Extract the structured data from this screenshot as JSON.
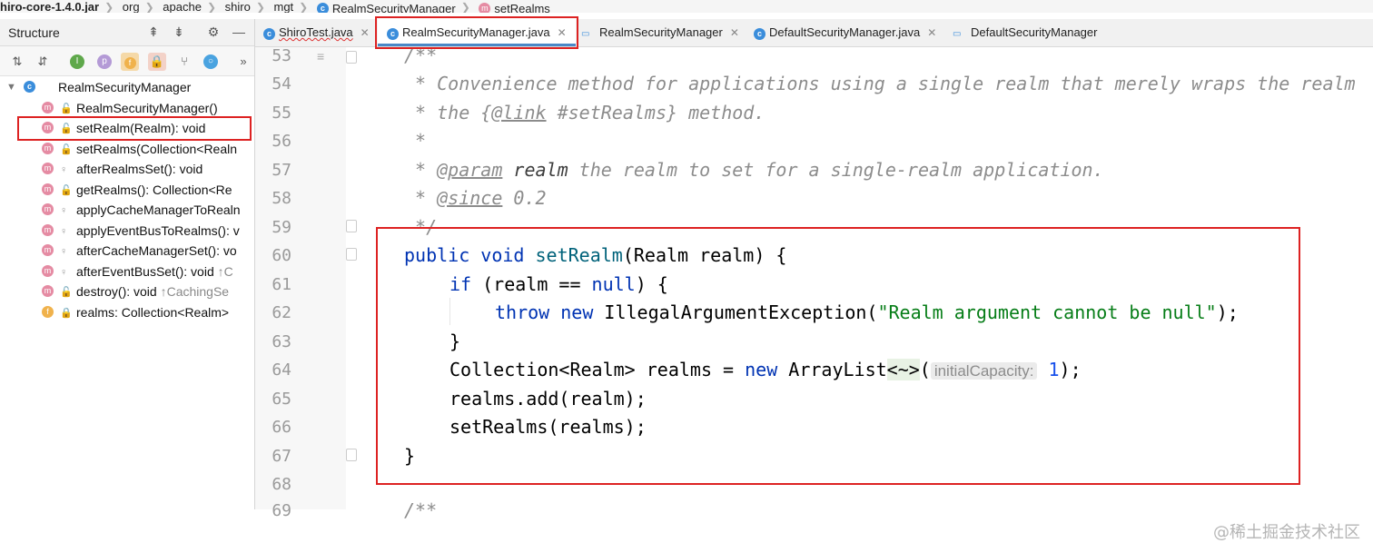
{
  "breadcrumb": [
    "hiro-core-1.4.0.jar",
    "org",
    "apache",
    "shiro",
    "mgt",
    "RealmSecurityManager",
    "setRealms"
  ],
  "structure": {
    "title": "Structure",
    "root": "RealmSecurityManager",
    "items": [
      {
        "label": "RealmSecurityManager()",
        "suffix": "",
        "kind": "m"
      },
      {
        "label": "setRealm(Realm): void",
        "suffix": "",
        "kind": "m"
      },
      {
        "label": "setRealms(Collection<Realn",
        "suffix": "",
        "kind": "m"
      },
      {
        "label": "afterRealmsSet(): void",
        "suffix": "",
        "kind": "m"
      },
      {
        "label": "getRealms(): Collection<Re",
        "suffix": "",
        "kind": "m"
      },
      {
        "label": "applyCacheManagerToRealn",
        "suffix": "",
        "kind": "m"
      },
      {
        "label": "applyEventBusToRealms(): v",
        "suffix": "",
        "kind": "m"
      },
      {
        "label": "afterCacheManagerSet(): vo",
        "suffix": "",
        "kind": "m"
      },
      {
        "label": "afterEventBusSet(): void ",
        "suffix": "↑C",
        "kind": "m"
      },
      {
        "label": "destroy(): void ",
        "suffix": "↑CachingSe",
        "kind": "m"
      },
      {
        "label": "realms: Collection<Realm>",
        "suffix": "",
        "kind": "f"
      }
    ]
  },
  "tabs": [
    {
      "label": "ShiroTest.java",
      "active": false
    },
    {
      "label": "RealmSecurityManager.java",
      "active": true
    },
    {
      "label": "RealmSecurityManager",
      "active": false
    },
    {
      "label": "DefaultSecurityManager.java",
      "active": false
    },
    {
      "label": "DefaultSecurityManager",
      "active": false
    }
  ],
  "editor": {
    "line_numbers": [
      "53",
      "54",
      "55",
      "56",
      "57",
      "58",
      "59",
      "60",
      "61",
      "62",
      "63",
      "64",
      "65",
      "66",
      "67",
      "68",
      "69"
    ],
    "code": {
      "l53": "/**",
      "l54": " * Convenience method for applications using a single realm that merely wraps the realm",
      "l55a": " * the {",
      "l55b": "@link",
      "l55c": " #setRealms} method.",
      "l56": " *",
      "l57a": " * ",
      "l57b": "@param",
      "l57c": " realm",
      "l57d": " the realm to set for a single-realm application.",
      "l58a": " * ",
      "l58b": "@since",
      "l58c": " 0.2",
      "l59": " */",
      "l60_kw": "public void",
      "l60_fn": "setRealm",
      "l60_rest": "(Realm realm) {",
      "l61_kw": "if",
      "l61_a": " (realm == ",
      "l61_null": "null",
      "l61_b": ") {",
      "l62_kw": "throw new",
      "l62_a": " IllegalArgumentException(",
      "l62_str": "\"Realm argument cannot be null\"",
      "l62_b": ");",
      "l63": "}",
      "l64_a": "Collection<Realm> realms = ",
      "l64_kw": "new",
      "l64_b": " ArrayList",
      "l64_diamond": "<~>",
      "l64_c": "(",
      "l64_hint": "initialCapacity:",
      "l64_num": "1",
      "l64_d": ");",
      "l65": "realms.add(realm);",
      "l66": "setRealms(realms);",
      "l67": "}",
      "l69": "/**"
    }
  },
  "watermark": "@稀土掘金技术社区",
  "colors": {
    "highlight_box": "#dd2222",
    "keyword": "#0033b3",
    "string": "#067d17",
    "comment": "#8c8c8c"
  }
}
